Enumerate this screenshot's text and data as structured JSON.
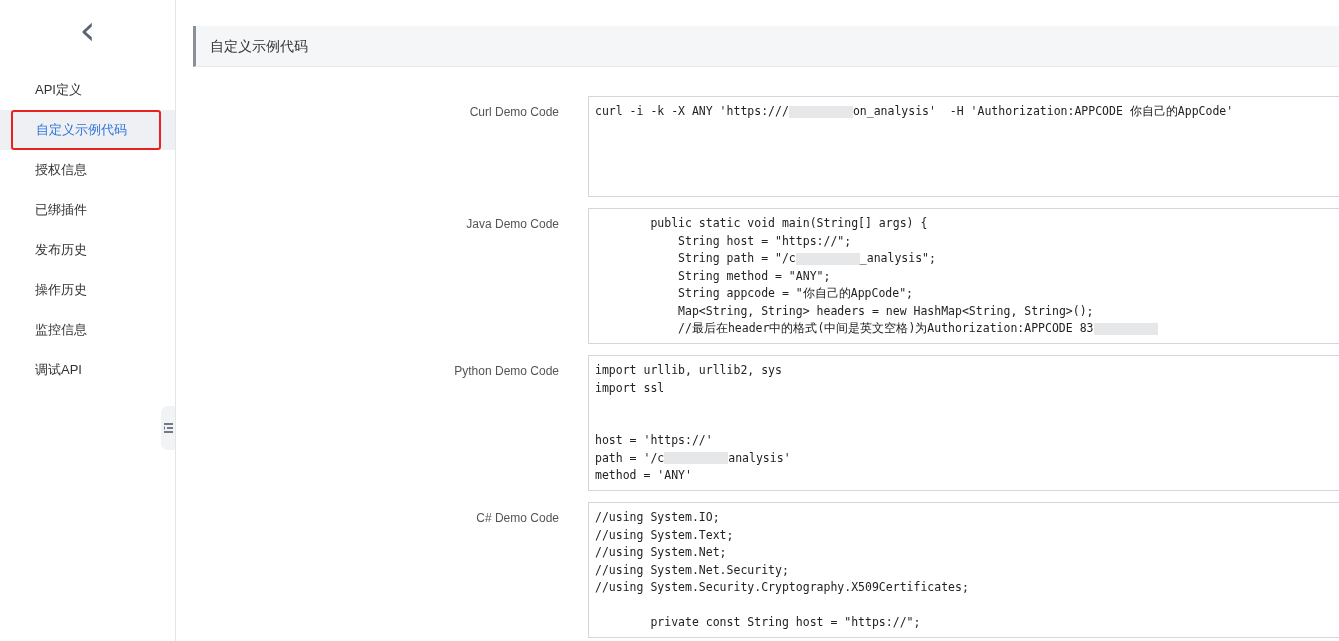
{
  "sidebar": {
    "back": "‹",
    "items": [
      {
        "label": "API定义",
        "selected": false
      },
      {
        "label": "自定义示例代码",
        "selected": true
      },
      {
        "label": "授权信息",
        "selected": false
      },
      {
        "label": "已绑插件",
        "selected": false
      },
      {
        "label": "发布历史",
        "selected": false
      },
      {
        "label": "操作历史",
        "selected": false
      },
      {
        "label": "监控信息",
        "selected": false
      },
      {
        "label": "调试API",
        "selected": false
      }
    ]
  },
  "section": {
    "title": "自定义示例代码"
  },
  "samples": [
    {
      "label": "Curl Demo Code",
      "lines": [
        {
          "kind": "code",
          "parts": [
            "curl -i -k -X ANY 'https:///",
            "on_analysis'  -H 'Authorization:APPCODE 你自己的AppCode'"
          ]
        }
      ]
    },
    {
      "label": "Java Demo Code",
      "lines": [
        {
          "kind": "code",
          "parts": [
            "        public static void main(String[] args) {"
          ]
        },
        {
          "kind": "code",
          "parts": [
            "            String host = \"https://\";"
          ]
        },
        {
          "kind": "code",
          "parts": [
            "            String path = \"/c",
            "_analysis\";"
          ]
        },
        {
          "kind": "code",
          "parts": [
            "            String method = \"ANY\";"
          ]
        },
        {
          "kind": "code",
          "parts": [
            "            String appcode = \"你自己的AppCode\";"
          ]
        },
        {
          "kind": "code",
          "parts": [
            "            Map<String, String> headers = new HashMap<String, String>();"
          ]
        },
        {
          "kind": "code",
          "parts": [
            "            //最后在header中的格式(中间是英文空格)为Authorization:APPCODE 83"
          ],
          "trailing_redaction": true
        }
      ]
    },
    {
      "label": "Python Demo Code",
      "lines": [
        {
          "kind": "code",
          "parts": [
            "import urllib, urllib2, sys"
          ]
        },
        {
          "kind": "code",
          "parts": [
            "import ssl"
          ]
        },
        {
          "kind": "blank"
        },
        {
          "kind": "blank"
        },
        {
          "kind": "code",
          "parts": [
            "host = 'https://'"
          ]
        },
        {
          "kind": "code",
          "parts": [
            "path = '/c",
            "analysis'"
          ]
        },
        {
          "kind": "code",
          "parts": [
            "method = 'ANY'"
          ]
        }
      ]
    },
    {
      "label": "C# Demo Code",
      "lines": [
        {
          "kind": "code",
          "parts": [
            "//using System.IO;"
          ]
        },
        {
          "kind": "code",
          "parts": [
            "//using System.Text;"
          ]
        },
        {
          "kind": "code",
          "parts": [
            "//using System.Net;"
          ]
        },
        {
          "kind": "code",
          "parts": [
            "//using System.Net.Security;"
          ]
        },
        {
          "kind": "code",
          "parts": [
            "//using System.Security.Cryptography.X509Certificates;"
          ]
        },
        {
          "kind": "blank"
        },
        {
          "kind": "code",
          "parts": [
            "        private const String host = \"https://\";"
          ]
        }
      ]
    }
  ]
}
